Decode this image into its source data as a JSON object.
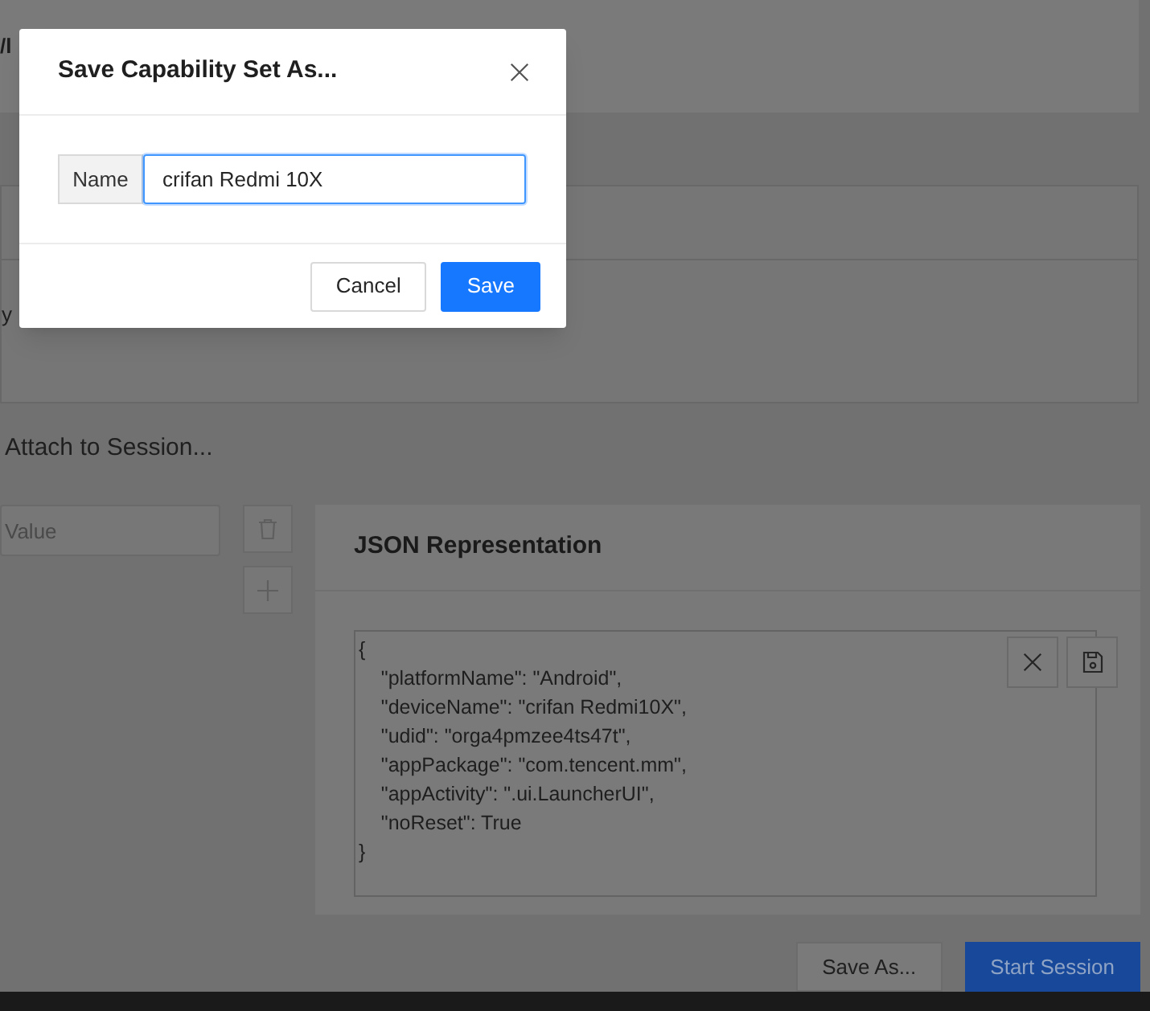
{
  "background": {
    "header_fragment": "/l",
    "field_label_fragment": "y",
    "attach_link": "Attach to Session...",
    "value_field": {
      "placeholder": "Value"
    },
    "json_panel": {
      "title": "JSON Representation",
      "text": "{\n    \"platformName\": \"Android\",\n    \"deviceName\": \"crifan Redmi10X\",\n    \"udid\": \"orga4pmzee4ts47t\",\n    \"appPackage\": \"com.tencent.mm\",\n    \"appActivity\": \".ui.LauncherUI\",\n    \"noReset\": True\n}"
    },
    "footer": {
      "buttons": [
        {
          "label": "Save As...",
          "kind": "secondary"
        },
        {
          "label": "Start Session",
          "kind": "primary"
        }
      ]
    }
  },
  "dialog": {
    "title": "Save Capability Set As...",
    "name_label": "Name",
    "name_field": {
      "value": "crifan Redmi 10X"
    },
    "buttons": [
      {
        "label": "Cancel",
        "kind": "secondary"
      },
      {
        "label": "Save",
        "kind": "primary"
      }
    ]
  }
}
